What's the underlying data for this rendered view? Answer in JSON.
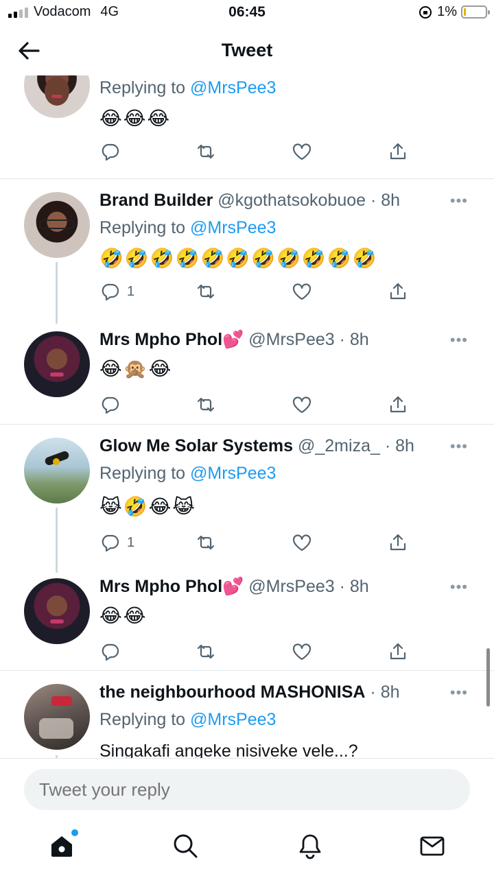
{
  "status_bar": {
    "carrier": "Vodacom",
    "network": "4G",
    "time": "06:45",
    "battery": "1%"
  },
  "header": {
    "title": "Tweet",
    "back_icon": "arrow-left-icon"
  },
  "tweets": [
    {
      "reply_label": "Replying to",
      "reply_mention": "@MrsPee3",
      "emojis": "😂😂😂"
    },
    {
      "name": "Brand Builder",
      "handle": "@kgothatsokobuoe · 8h",
      "reply_label": "Replying to",
      "reply_mention": "@MrsPee3",
      "emojis": "🤣🤣🤣🤣🤣🤣🤣🤣🤣🤣🤣",
      "reply_count": "1"
    },
    {
      "name": "Mrs Mpho Phol💕",
      "handle": "@MrsPee3 · 8h",
      "emojis": "😂🙊😂"
    },
    {
      "name": "Glow Me Solar Systems",
      "handle": "@_2miza_ · 8h",
      "reply_label": "Replying to",
      "reply_mention": "@MrsPee3",
      "emojis": "😹🤣😂😹",
      "reply_count": "1"
    },
    {
      "name": "Mrs Mpho Phol💕",
      "handle": "@MrsPee3 · 8h",
      "emojis": "😂😂"
    },
    {
      "name": "the neighbourhood MASHONISA",
      "handle": "· 8h",
      "reply_label": "Replying to",
      "reply_mention": "@MrsPee3",
      "text": "Singakafi angeke nisiveke vele...?"
    }
  ],
  "more_label": "•••",
  "reply_box": {
    "placeholder": "Tweet your reply"
  },
  "tabs": [
    "home-icon",
    "search-icon",
    "bell-icon",
    "mail-icon"
  ],
  "colors": {
    "accent": "#1d9bf0",
    "muted": "#536471",
    "divider": "#e3e6e8"
  }
}
